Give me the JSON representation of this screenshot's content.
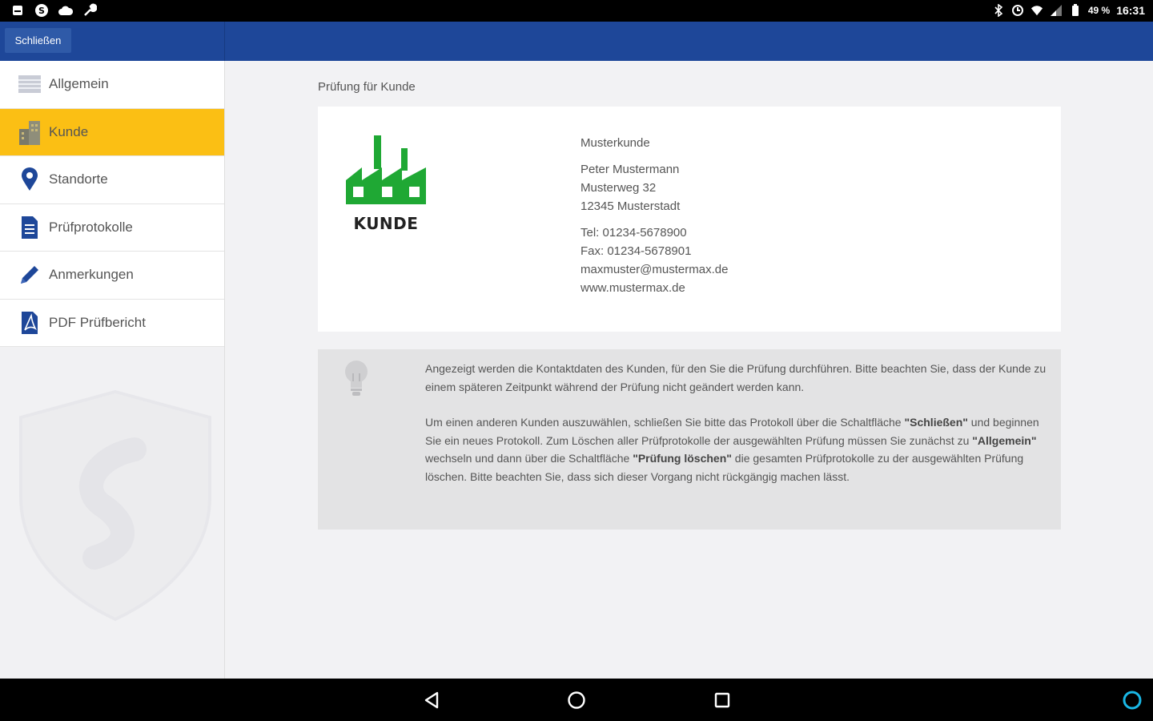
{
  "statusbar": {
    "battery": "49 %",
    "time": "16:31"
  },
  "appbar": {
    "close_label": "Schließen"
  },
  "sidebar": {
    "items": [
      {
        "label": "Allgemein",
        "icon": "list-icon",
        "active": false
      },
      {
        "label": "Kunde",
        "icon": "building-icon",
        "active": true
      },
      {
        "label": "Standorte",
        "icon": "location-pin-icon",
        "active": false
      },
      {
        "label": "Prüfprotokolle",
        "icon": "document-icon",
        "active": false
      },
      {
        "label": "Anmerkungen",
        "icon": "pencil-icon",
        "active": false
      },
      {
        "label": "PDF Prüfbericht",
        "icon": "pdf-icon",
        "active": false
      }
    ]
  },
  "main": {
    "title": "Prüfung für Kunde",
    "logo_text": "KUNDE",
    "contact": {
      "company": "Musterkunde",
      "person": "Peter Mustermann",
      "street": "Musterweg 32",
      "city": "12345 Musterstadt",
      "phone": "Tel: 01234-5678900",
      "fax": "Fax: 01234-5678901",
      "email": "maxmuster@mustermax.de",
      "web": "www.mustermax.de"
    },
    "info": {
      "p1": "Angezeigt werden die Kontaktdaten des Kunden, für den Sie die Prüfung durchführen. Bitte beachten Sie, dass der Kunde zu einem späteren Zeitpunkt während der Prüfung nicht geändert werden kann.",
      "p2_a": "Um einen anderen Kunden auszuwählen, schließen Sie bitte das Protokoll über die Schaltfläche ",
      "p2_b": "\"Schließen\"",
      "p2_c": " und beginnen Sie ein neues Protokoll. Zum Löschen aller Prüfprotokolle der ausgewählten Prüfung müssen Sie zunächst zu ",
      "p2_d": "\"Allgemein\"",
      "p2_e": " wechseln und dann über die Schaltfläche ",
      "p2_f": "\"Prüfung löschen\"",
      "p2_g": " die gesamten Prüfprotokolle zu der ausgewählten Prüfung löschen. Bitte beachten Sie, dass sich dieser Vorgang nicht rückgängig machen lässt."
    }
  },
  "colors": {
    "appbar": "#1e4799",
    "active_nav": "#fbbf14",
    "logo_green": "#1fa834"
  }
}
